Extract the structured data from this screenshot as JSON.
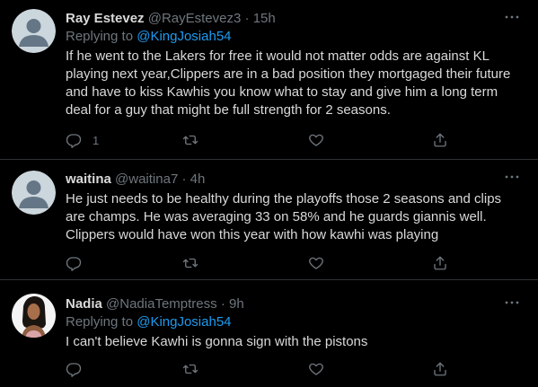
{
  "colors": {
    "background": "#000000",
    "text": "#d9d9d9",
    "muted": "#6e767d",
    "link": "#1d9bf0",
    "divider": "#2f3336"
  },
  "tweets": [
    {
      "name": "Ray Estevez",
      "handle": "@RayEstevez3",
      "separator": "·",
      "time": "15h",
      "replying_prefix": "Replying to ",
      "replying_to": "@KingJosiah54",
      "text": "If he went to the Lakers for free it would not matter odds are against KL playing next year,Clippers are in a bad position they mortgaged their future and have to kiss Kawhis you know what to stay and give him a long term deal for a guy that might be full strength for 2 seasons.",
      "reply_count": "1",
      "avatar": "default-avatar"
    },
    {
      "name": "waitina",
      "handle": "@waitina7",
      "separator": "·",
      "time": "4h",
      "text": "He just needs to be healthy during the playoffs those 2 seasons and clips are champs. He was averaging 33 on 58% and he guards giannis well. Clippers would have won this year with how kawhi was playing",
      "avatar": "default-avatar"
    },
    {
      "name": "Nadia",
      "handle": "@NadiaTemptress",
      "separator": "·",
      "time": "9h",
      "replying_prefix": "Replying to ",
      "replying_to": "@KingJosiah54",
      "text": "I can't believe Kawhi is gonna sign with the pistons",
      "avatar": "profile-photo"
    }
  ],
  "icons": {
    "reply": "reply-icon",
    "retweet": "retweet-icon",
    "like": "heart-icon",
    "share": "share-icon",
    "more": "more-icon"
  }
}
